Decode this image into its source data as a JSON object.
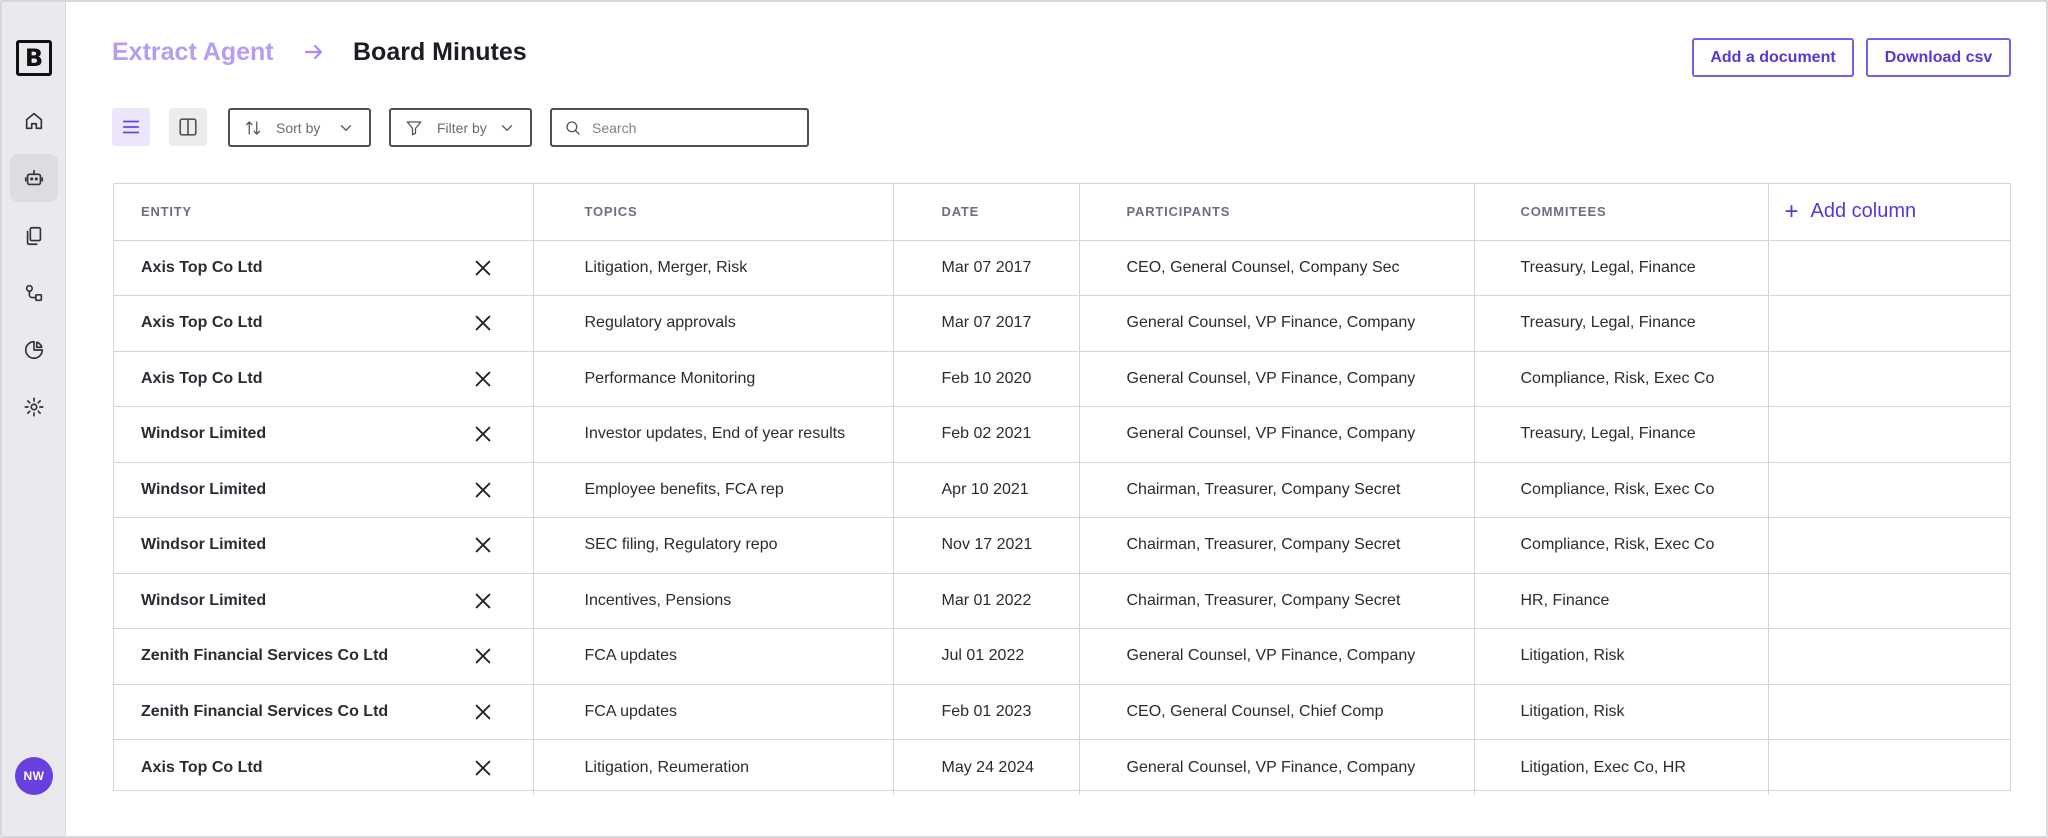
{
  "sidebar": {
    "logo_letter": "B",
    "items": [
      {
        "name": "home",
        "icon": "home-icon",
        "active": false
      },
      {
        "name": "agents",
        "icon": "robot-icon",
        "active": true
      },
      {
        "name": "documents",
        "icon": "documents-icon",
        "active": false
      },
      {
        "name": "workflows",
        "icon": "workflow-icon",
        "active": false
      },
      {
        "name": "analytics",
        "icon": "pie-chart-icon",
        "active": false
      },
      {
        "name": "settings",
        "icon": "gear-icon",
        "active": false
      }
    ],
    "avatar_initials": "NW"
  },
  "header": {
    "breadcrumb_root": "Extract Agent",
    "title": "Board Minutes",
    "add_document_label": "Add a document",
    "download_label": "Download csv"
  },
  "toolbar": {
    "sort_label": "Sort by",
    "filter_label": "Filter by",
    "search_placeholder": "Search",
    "search_value": ""
  },
  "table": {
    "columns": [
      "ENTITY",
      "TOPICS",
      "DATE",
      "PARTICIPANTS",
      "COMMITEES"
    ],
    "add_column_label": "Add column",
    "rows": [
      {
        "entity": "Axis Top Co Ltd",
        "topics": "Litigation, Merger, Risk",
        "date": "Mar 07 2017",
        "participants": "CEO, General Counsel, Company Sec",
        "committees": "Treasury, Legal, Finance"
      },
      {
        "entity": "Axis Top Co Ltd",
        "topics": "Regulatory approvals",
        "date": "Mar 07 2017",
        "participants": "General Counsel, VP Finance, Company",
        "committees": "Treasury, Legal, Finance"
      },
      {
        "entity": "Axis Top Co Ltd",
        "topics": "Performance Monitoring",
        "date": "Feb 10 2020",
        "participants": "General Counsel, VP Finance, Company",
        "committees": "Compliance, Risk, Exec Co"
      },
      {
        "entity": "Windsor Limited",
        "topics": "Investor updates, End of year results",
        "date": "Feb 02 2021",
        "participants": "General Counsel, VP Finance, Company",
        "committees": "Treasury, Legal, Finance"
      },
      {
        "entity": "Windsor Limited",
        "topics": "Employee benefits, FCA rep",
        "date": "Apr 10 2021",
        "participants": "Chairman, Treasurer, Company Secret",
        "committees": "Compliance, Risk, Exec Co"
      },
      {
        "entity": "Windsor Limited",
        "topics": "SEC filing, Regulatory repo",
        "date": "Nov 17 2021",
        "participants": "Chairman, Treasurer, Company Secret",
        "committees": "Compliance, Risk, Exec Co"
      },
      {
        "entity": "Windsor Limited",
        "topics": "Incentives, Pensions",
        "date": "Mar 01 2022",
        "participants": "Chairman, Treasurer, Company Secret",
        "committees": "HR, Finance"
      },
      {
        "entity": "Zenith Financial Services Co Ltd",
        "topics": "FCA updates",
        "date": "Jul 01 2022",
        "participants": "General Counsel, VP Finance, Company",
        "committees": "Litigation, Risk"
      },
      {
        "entity": "Zenith Financial Services Co Ltd",
        "topics": "FCA updates",
        "date": "Feb 01 2023",
        "participants": "CEO, General Counsel, Chief Comp",
        "committees": "Litigation, Risk"
      },
      {
        "entity": "Axis Top Co Ltd",
        "topics": "Litigation, Reumeration",
        "date": "May 24 2024",
        "participants": "General Counsel, VP Finance, Company",
        "committees": "Litigation, Exec Co, HR"
      }
    ]
  },
  "colors": {
    "accent": "#5b34d9",
    "accent_light": "#b79cf3",
    "sidebar_bg": "#e9e9ee",
    "avatar_bg": "#6a3fe0"
  }
}
